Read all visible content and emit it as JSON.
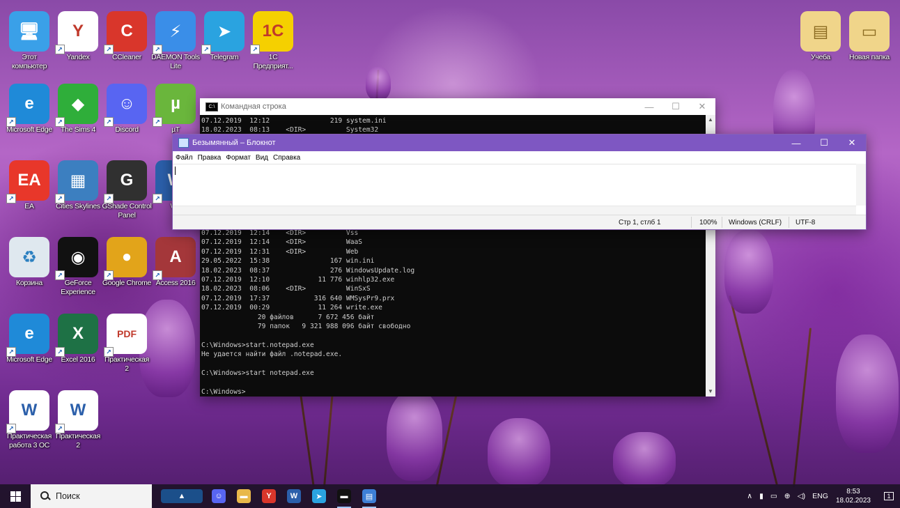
{
  "desktop_icons": [
    {
      "label": "Этот компьютер",
      "glyph": "🖥",
      "color": "#3aa0e8"
    },
    {
      "label": "Yandex",
      "glyph": "Y",
      "color": "#ffffff"
    },
    {
      "label": "CCleaner",
      "glyph": "C",
      "color": "#d9362b"
    },
    {
      "label": "DAEMON Tools Lite",
      "glyph": "⚡",
      "color": "#3a8ee8"
    },
    {
      "label": "Telegram",
      "glyph": "➤",
      "color": "#2aa3e0"
    },
    {
      "label": "1С Предприят...",
      "glyph": "1С",
      "color": "#f5d000"
    },
    {
      "label": "Microsoft Edge",
      "glyph": "e",
      "color": "#1f8ad8"
    },
    {
      "label": "The Sims 4",
      "glyph": "◆",
      "color": "#2fae3a"
    },
    {
      "label": "Discord",
      "glyph": "☺",
      "color": "#5865f2"
    },
    {
      "label": "µT",
      "glyph": "µ",
      "color": "#6ab63c"
    },
    {
      "label": "EA",
      "glyph": "EA",
      "color": "#e8372a"
    },
    {
      "label": "Cities Skylines",
      "glyph": "▦",
      "color": "#3c7fc0"
    },
    {
      "label": "GShade Control Panel",
      "glyph": "G",
      "color": "#303030"
    },
    {
      "label": "Wo",
      "glyph": "W",
      "color": "#2b5faa"
    },
    {
      "label": "Корзина",
      "glyph": "♻",
      "color": "#dfe8ef"
    },
    {
      "label": "GeForce Experience",
      "glyph": "◉",
      "color": "#111111"
    },
    {
      "label": "Google Chrome",
      "glyph": "●",
      "color": "#e2a41a"
    },
    {
      "label": "Access 2016",
      "glyph": "A",
      "color": "#a4373a"
    },
    {
      "label": "Microsoft Edge",
      "glyph": "e",
      "color": "#1f8ad8"
    },
    {
      "label": "Excel 2016",
      "glyph": "X",
      "color": "#1e7145"
    },
    {
      "label": "Практическая 2",
      "glyph": "PDF",
      "color": "#ffffff"
    },
    {
      "label": "Практическая работа 3 ОС",
      "glyph": "W",
      "color": "#ffffff"
    },
    {
      "label": "Практическая 2",
      "glyph": "W",
      "color": "#ffffff"
    },
    {
      "label": "Учеба",
      "glyph": "▤",
      "color": "#f0d58a"
    },
    {
      "label": "Новая папка",
      "glyph": "▭",
      "color": "#f0d58a"
    }
  ],
  "cmd": {
    "title": "Командная строка",
    "lines": [
      "07.12.2019  12:12               219 system.ini",
      "18.02.2023  08:13    <DIR>          System32",
      "",
      "",
      "",
      "",
      "",
      "",
      "",
      "",
      "",
      "",
      "07.12.2019  12:14    <DIR>          Vss",
      "07.12.2019  12:14    <DIR>          WaaS",
      "07.12.2019  12:31    <DIR>          Web",
      "29.05.2022  15:38               167 win.ini",
      "18.02.2023  08:37               276 WindowsUpdate.log",
      "07.12.2019  12:10            11 776 winhlp32.exe",
      "18.02.2023  08:06    <DIR>          WinSxS",
      "07.12.2019  17:37           316 640 WMSysPr9.prx",
      "07.12.2019  00:29            11 264 write.exe",
      "              20 файлов      7 672 456 байт",
      "              79 папок   9 321 988 096 байт свободно",
      "",
      "C:\\Windows>start.notepad.exe",
      "Не удается найти файл .notepad.exe.",
      "",
      "C:\\Windows>start notepad.exe",
      "",
      "C:\\Windows>"
    ]
  },
  "notepad": {
    "title": "Безымянный – Блокнот",
    "menu": [
      "Файл",
      "Правка",
      "Формат",
      "Вид",
      "Справка"
    ],
    "status": {
      "position": "Стр 1, стлб 1",
      "zoom": "100%",
      "line_ending": "Windows (CRLF)",
      "encoding": "UTF-8"
    }
  },
  "window_controls": {
    "minimize": "—",
    "maximize": "☐",
    "close": "✕"
  },
  "taskbar": {
    "search_placeholder": "Поиск",
    "apps": [
      {
        "name": "widget",
        "glyph": "▲",
        "color": "#1b4f8a"
      },
      {
        "name": "discord",
        "glyph": "☺",
        "color": "#5865f2"
      },
      {
        "name": "explorer",
        "glyph": "▬",
        "color": "#e8b84a"
      },
      {
        "name": "yandex",
        "glyph": "Y",
        "color": "#d9362b"
      },
      {
        "name": "word",
        "glyph": "W",
        "color": "#2b5faa"
      },
      {
        "name": "telegram",
        "glyph": "➤",
        "color": "#2aa3e0"
      },
      {
        "name": "cmd",
        "glyph": "▬",
        "color": "#111111"
      },
      {
        "name": "notepad",
        "glyph": "▤",
        "color": "#3d7fd6"
      }
    ],
    "tray": {
      "chevron": "∧",
      "lang": "ENG",
      "time": "8:53",
      "date": "18.02.2023",
      "notifications": "1"
    }
  }
}
